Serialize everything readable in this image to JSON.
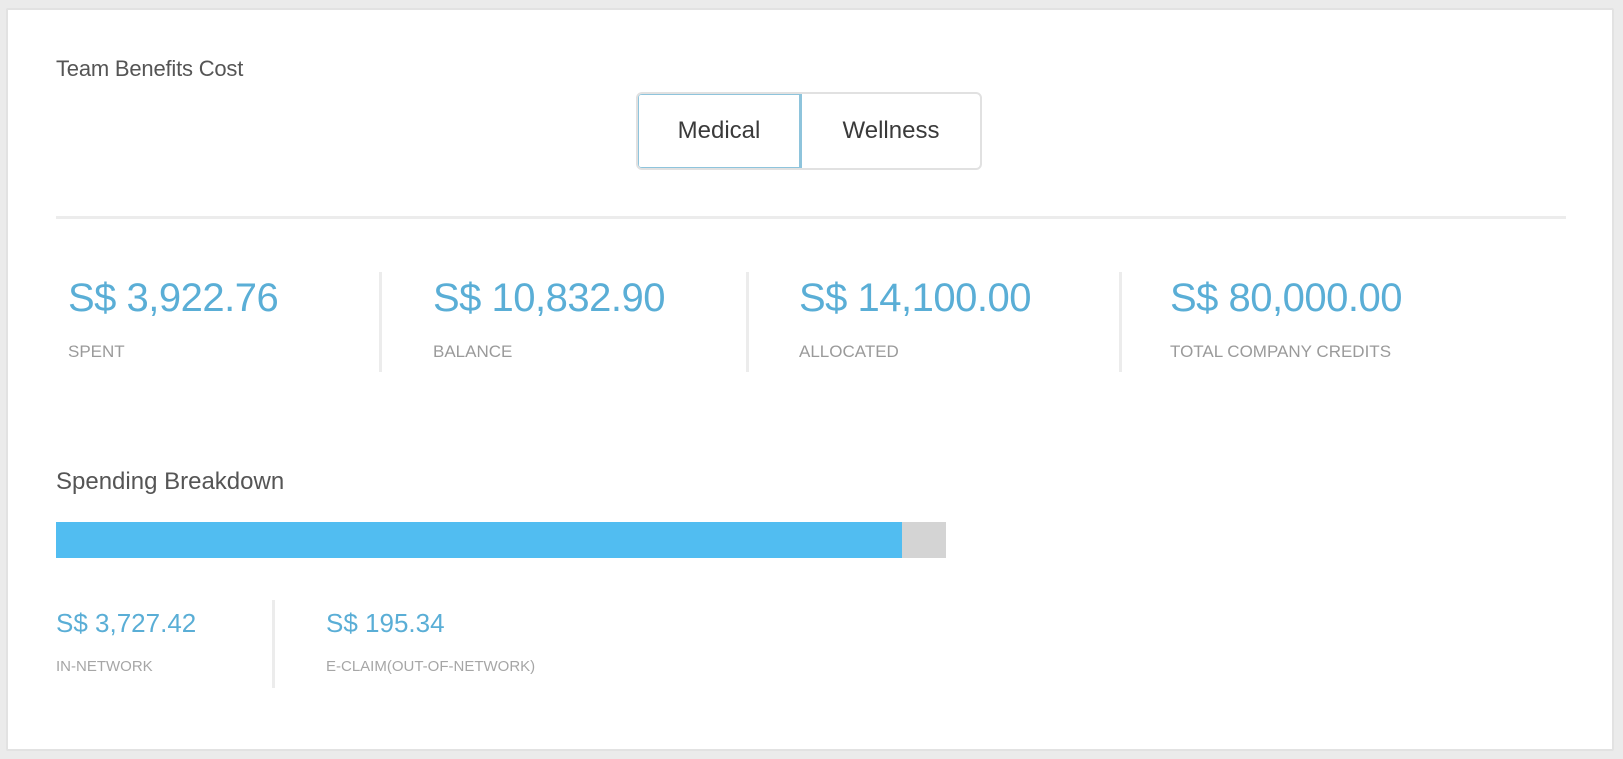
{
  "card": {
    "title": "Team Benefits Cost"
  },
  "toggle": {
    "options": [
      "Medical",
      "Wellness"
    ],
    "selected": "Medical"
  },
  "stats": [
    {
      "amount": "S$ 3,922.76",
      "label": "SPENT"
    },
    {
      "amount": "S$ 10,832.90",
      "label": "BALANCE"
    },
    {
      "amount": "S$ 14,100.00",
      "label": "ALLOCATED"
    },
    {
      "amount": "S$ 80,000.00",
      "label": "TOTAL COMPANY CREDITS"
    }
  ],
  "spending": {
    "title": "Spending Breakdown",
    "progress_fraction": 0.95,
    "items": [
      {
        "amount": "S$ 3,727.42",
        "label": "IN-NETWORK"
      },
      {
        "amount": "S$ 195.34",
        "label": "E-CLAIM(OUT-OF-NETWORK)"
      }
    ]
  },
  "colors": {
    "accent_text": "#5aaed6",
    "progress_fill": "#51bdf1",
    "progress_track": "#d4d4d4",
    "toggle_active_border": "#8ec4dc"
  }
}
